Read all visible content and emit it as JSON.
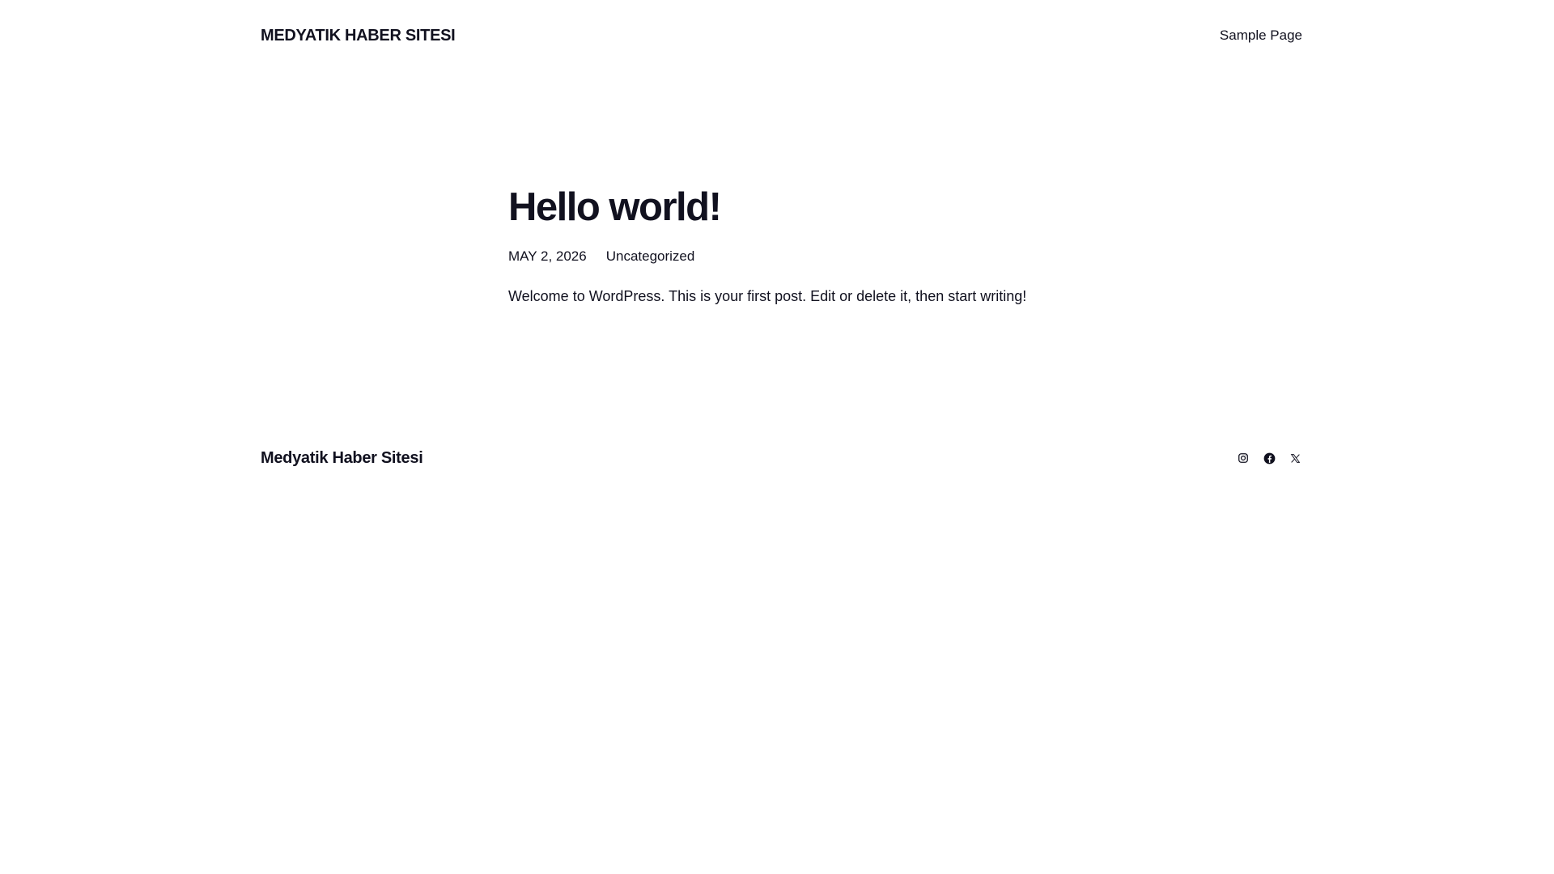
{
  "header": {
    "site_title": "MEDYATIK HABER SITESI",
    "nav": [
      {
        "label": "Sample Page"
      }
    ]
  },
  "post": {
    "title": "Hello world!",
    "date": "MAY 2, 2026",
    "category": "Uncategorized",
    "excerpt": "Welcome to WordPress. This is your first post. Edit or delete it, then start writing!"
  },
  "footer": {
    "site_title": "Medyatik Haber Sitesi",
    "social": [
      {
        "icon": "instagram-icon"
      },
      {
        "icon": "facebook-icon"
      },
      {
        "icon": "x-twitter-icon"
      }
    ]
  },
  "colors": {
    "text": "#11111f",
    "background": "#ffffff"
  }
}
